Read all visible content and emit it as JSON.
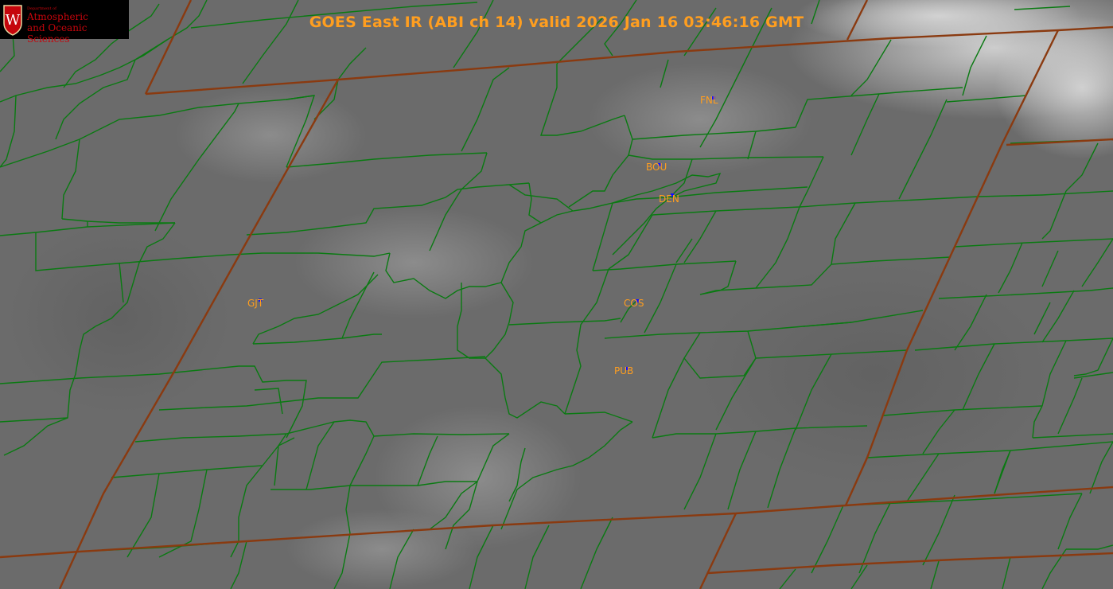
{
  "title": "GOES East IR (ABI ch 14) valid 2026 Jan 16 03:46:16 GMT",
  "logo": {
    "line1": "Department of",
    "line2": "Atmospheric",
    "line3": "and Oceanic Sciences",
    "crest_letter": "W"
  },
  "stations": [
    {
      "id": "FNL",
      "label": "FNL"
    },
    {
      "id": "BOU",
      "label": "BOU"
    },
    {
      "id": "DEN",
      "label": "DEN"
    },
    {
      "id": "GJT",
      "label": "GJT"
    },
    {
      "id": "COS",
      "label": "COS"
    },
    {
      "id": "PUB",
      "label": "PUB"
    }
  ],
  "colors": {
    "background_gray": "#6c6c6c",
    "county_line": "#0a7a12",
    "state_line": "#8a3a10",
    "label_text": "#ff9e1f",
    "station_marker": "#1010ff",
    "logo_red": "#c5050c"
  }
}
